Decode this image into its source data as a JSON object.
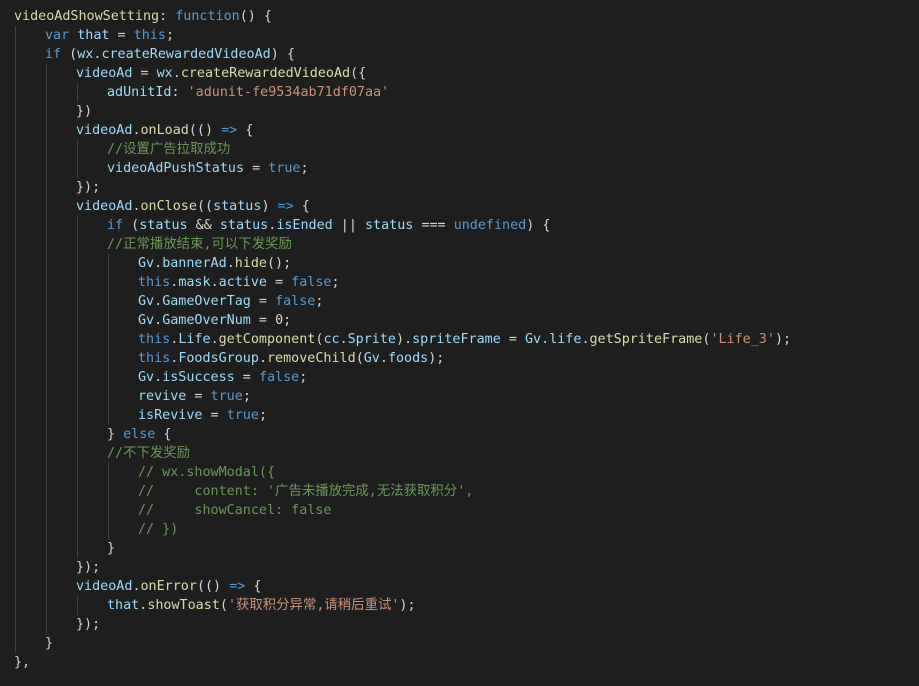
{
  "editor": {
    "theme": {
      "background": "#1e1e1e",
      "keyword": "#569cd6",
      "variable": "#9cdcfe",
      "function": "#dcdcaa",
      "string": "#ce9178",
      "comment": "#6a9955",
      "plain": "#d4d4d4"
    },
    "lines": [
      {
        "indent": 0,
        "tokens": [
          {
            "t": "videoAdShowSetting",
            "c": "function"
          },
          {
            "t": ": ",
            "c": "plain"
          },
          {
            "t": "function",
            "c": "keyword"
          },
          {
            "t": "() {",
            "c": "plain"
          }
        ]
      },
      {
        "indent": 1,
        "tokens": [
          {
            "t": "var",
            "c": "keyword"
          },
          {
            "t": " ",
            "c": "plain"
          },
          {
            "t": "that",
            "c": "variable"
          },
          {
            "t": " = ",
            "c": "plain"
          },
          {
            "t": "this",
            "c": "keyword"
          },
          {
            "t": ";",
            "c": "plain"
          }
        ]
      },
      {
        "indent": 1,
        "tokens": [
          {
            "t": "if",
            "c": "keyword"
          },
          {
            "t": " (",
            "c": "plain"
          },
          {
            "t": "wx",
            "c": "variable"
          },
          {
            "t": ".",
            "c": "plain"
          },
          {
            "t": "createRewardedVideoAd",
            "c": "variable"
          },
          {
            "t": ") {",
            "c": "plain"
          }
        ]
      },
      {
        "indent": 2,
        "tokens": [
          {
            "t": "videoAd",
            "c": "variable"
          },
          {
            "t": " = ",
            "c": "plain"
          },
          {
            "t": "wx",
            "c": "variable"
          },
          {
            "t": ".",
            "c": "plain"
          },
          {
            "t": "createRewardedVideoAd",
            "c": "function"
          },
          {
            "t": "({",
            "c": "plain"
          }
        ]
      },
      {
        "indent": 3,
        "tokens": [
          {
            "t": "adUnitId",
            "c": "variable"
          },
          {
            "t": ": ",
            "c": "plain"
          },
          {
            "t": "'adunit-fe9534ab71df07aa'",
            "c": "string"
          }
        ]
      },
      {
        "indent": 2,
        "tokens": [
          {
            "t": "})",
            "c": "plain"
          }
        ]
      },
      {
        "indent": 2,
        "tokens": [
          {
            "t": "videoAd",
            "c": "variable"
          },
          {
            "t": ".",
            "c": "plain"
          },
          {
            "t": "onLoad",
            "c": "function"
          },
          {
            "t": "(() ",
            "c": "plain"
          },
          {
            "t": "=>",
            "c": "keyword"
          },
          {
            "t": " {",
            "c": "plain"
          }
        ]
      },
      {
        "indent": 3,
        "tokens": [
          {
            "t": "//设置广告拉取成功",
            "c": "comment"
          }
        ]
      },
      {
        "indent": 3,
        "tokens": [
          {
            "t": "videoAdPushStatus",
            "c": "variable"
          },
          {
            "t": " = ",
            "c": "plain"
          },
          {
            "t": "true",
            "c": "keyword"
          },
          {
            "t": ";",
            "c": "plain"
          }
        ]
      },
      {
        "indent": 2,
        "tokens": [
          {
            "t": "});",
            "c": "plain"
          }
        ]
      },
      {
        "indent": 2,
        "tokens": [
          {
            "t": "videoAd",
            "c": "variable"
          },
          {
            "t": ".",
            "c": "plain"
          },
          {
            "t": "onClose",
            "c": "function"
          },
          {
            "t": "((",
            "c": "plain"
          },
          {
            "t": "status",
            "c": "variable"
          },
          {
            "t": ") ",
            "c": "plain"
          },
          {
            "t": "=>",
            "c": "keyword"
          },
          {
            "t": " {",
            "c": "plain"
          }
        ]
      },
      {
        "indent": 3,
        "tokens": [
          {
            "t": "if",
            "c": "keyword"
          },
          {
            "t": " (",
            "c": "plain"
          },
          {
            "t": "status",
            "c": "variable"
          },
          {
            "t": " && ",
            "c": "plain"
          },
          {
            "t": "status",
            "c": "variable"
          },
          {
            "t": ".",
            "c": "plain"
          },
          {
            "t": "isEnded",
            "c": "variable"
          },
          {
            "t": " || ",
            "c": "plain"
          },
          {
            "t": "status",
            "c": "variable"
          },
          {
            "t": " === ",
            "c": "plain"
          },
          {
            "t": "undefined",
            "c": "keyword"
          },
          {
            "t": ") {",
            "c": "plain"
          }
        ]
      },
      {
        "indent": 3,
        "tokens": [
          {
            "t": "//正常播放结束,可以下发奖励",
            "c": "comment"
          }
        ]
      },
      {
        "indent": 4,
        "tokens": [
          {
            "t": "Gv",
            "c": "variable"
          },
          {
            "t": ".",
            "c": "plain"
          },
          {
            "t": "bannerAd",
            "c": "variable"
          },
          {
            "t": ".",
            "c": "plain"
          },
          {
            "t": "hide",
            "c": "function"
          },
          {
            "t": "();",
            "c": "plain"
          }
        ]
      },
      {
        "indent": 4,
        "tokens": [
          {
            "t": "this",
            "c": "keyword"
          },
          {
            "t": ".",
            "c": "plain"
          },
          {
            "t": "mask",
            "c": "variable"
          },
          {
            "t": ".",
            "c": "plain"
          },
          {
            "t": "active",
            "c": "variable"
          },
          {
            "t": " = ",
            "c": "plain"
          },
          {
            "t": "false",
            "c": "keyword"
          },
          {
            "t": ";",
            "c": "plain"
          }
        ]
      },
      {
        "indent": 4,
        "tokens": [
          {
            "t": "Gv",
            "c": "variable"
          },
          {
            "t": ".",
            "c": "plain"
          },
          {
            "t": "GameOverTag",
            "c": "variable"
          },
          {
            "t": " = ",
            "c": "plain"
          },
          {
            "t": "false",
            "c": "keyword"
          },
          {
            "t": ";",
            "c": "plain"
          }
        ]
      },
      {
        "indent": 4,
        "tokens": [
          {
            "t": "Gv",
            "c": "variable"
          },
          {
            "t": ".",
            "c": "plain"
          },
          {
            "t": "GameOverNum",
            "c": "variable"
          },
          {
            "t": " = ",
            "c": "plain"
          },
          {
            "t": "0",
            "c": "plain"
          },
          {
            "t": ";",
            "c": "plain"
          }
        ]
      },
      {
        "indent": 4,
        "tokens": [
          {
            "t": "this",
            "c": "keyword"
          },
          {
            "t": ".",
            "c": "plain"
          },
          {
            "t": "Life",
            "c": "variable"
          },
          {
            "t": ".",
            "c": "plain"
          },
          {
            "t": "getComponent",
            "c": "function"
          },
          {
            "t": "(",
            "c": "plain"
          },
          {
            "t": "cc",
            "c": "variable"
          },
          {
            "t": ".",
            "c": "plain"
          },
          {
            "t": "Sprite",
            "c": "variable"
          },
          {
            "t": ").",
            "c": "plain"
          },
          {
            "t": "spriteFrame",
            "c": "variable"
          },
          {
            "t": " = ",
            "c": "plain"
          },
          {
            "t": "Gv",
            "c": "variable"
          },
          {
            "t": ".",
            "c": "plain"
          },
          {
            "t": "life",
            "c": "variable"
          },
          {
            "t": ".",
            "c": "plain"
          },
          {
            "t": "getSpriteFrame",
            "c": "function"
          },
          {
            "t": "(",
            "c": "plain"
          },
          {
            "t": "'Life_3'",
            "c": "string"
          },
          {
            "t": ");",
            "c": "plain"
          }
        ]
      },
      {
        "indent": 4,
        "tokens": [
          {
            "t": "this",
            "c": "keyword"
          },
          {
            "t": ".",
            "c": "plain"
          },
          {
            "t": "FoodsGroup",
            "c": "variable"
          },
          {
            "t": ".",
            "c": "plain"
          },
          {
            "t": "removeChild",
            "c": "function"
          },
          {
            "t": "(",
            "c": "plain"
          },
          {
            "t": "Gv",
            "c": "variable"
          },
          {
            "t": ".",
            "c": "plain"
          },
          {
            "t": "foods",
            "c": "variable"
          },
          {
            "t": ");",
            "c": "plain"
          }
        ]
      },
      {
        "indent": 4,
        "tokens": [
          {
            "t": "Gv",
            "c": "variable"
          },
          {
            "t": ".",
            "c": "plain"
          },
          {
            "t": "isSuccess",
            "c": "variable"
          },
          {
            "t": " = ",
            "c": "plain"
          },
          {
            "t": "false",
            "c": "keyword"
          },
          {
            "t": ";",
            "c": "plain"
          }
        ]
      },
      {
        "indent": 4,
        "tokens": [
          {
            "t": "revive",
            "c": "variable"
          },
          {
            "t": " = ",
            "c": "plain"
          },
          {
            "t": "true",
            "c": "keyword"
          },
          {
            "t": ";",
            "c": "plain"
          }
        ]
      },
      {
        "indent": 4,
        "tokens": [
          {
            "t": "isRevive",
            "c": "variable"
          },
          {
            "t": " = ",
            "c": "plain"
          },
          {
            "t": "true",
            "c": "keyword"
          },
          {
            "t": ";",
            "c": "plain"
          }
        ]
      },
      {
        "indent": 3,
        "tokens": [
          {
            "t": "} ",
            "c": "plain"
          },
          {
            "t": "else",
            "c": "keyword"
          },
          {
            "t": " {",
            "c": "plain"
          }
        ]
      },
      {
        "indent": 3,
        "tokens": [
          {
            "t": "//不下发奖励",
            "c": "comment"
          }
        ]
      },
      {
        "indent": 4,
        "tokens": [
          {
            "t": "// wx.showModal({",
            "c": "comment"
          }
        ]
      },
      {
        "indent": 4,
        "tokens": [
          {
            "t": "//     content: '广告未播放完成,无法获取积分',",
            "c": "comment"
          }
        ]
      },
      {
        "indent": 4,
        "tokens": [
          {
            "t": "//     showCancel: false",
            "c": "comment"
          }
        ]
      },
      {
        "indent": 4,
        "tokens": [
          {
            "t": "// })",
            "c": "comment"
          }
        ]
      },
      {
        "indent": 3,
        "tokens": [
          {
            "t": "}",
            "c": "plain"
          }
        ]
      },
      {
        "indent": 2,
        "tokens": [
          {
            "t": "});",
            "c": "plain"
          }
        ]
      },
      {
        "indent": 2,
        "tokens": [
          {
            "t": "videoAd",
            "c": "variable"
          },
          {
            "t": ".",
            "c": "plain"
          },
          {
            "t": "onError",
            "c": "function"
          },
          {
            "t": "(() ",
            "c": "plain"
          },
          {
            "t": "=>",
            "c": "keyword"
          },
          {
            "t": " {",
            "c": "plain"
          }
        ]
      },
      {
        "indent": 3,
        "tokens": [
          {
            "t": "that",
            "c": "variable"
          },
          {
            "t": ".",
            "c": "plain"
          },
          {
            "t": "showToast",
            "c": "function"
          },
          {
            "t": "(",
            "c": "plain"
          },
          {
            "t": "'获取积分异常,请稍后重试'",
            "c": "string"
          },
          {
            "t": ");",
            "c": "plain"
          }
        ]
      },
      {
        "indent": 2,
        "tokens": [
          {
            "t": "});",
            "c": "plain"
          }
        ]
      },
      {
        "indent": 1,
        "tokens": [
          {
            "t": "}",
            "c": "plain"
          }
        ]
      },
      {
        "indent": 0,
        "tokens": [
          {
            "t": "},",
            "c": "plain"
          }
        ]
      }
    ]
  }
}
